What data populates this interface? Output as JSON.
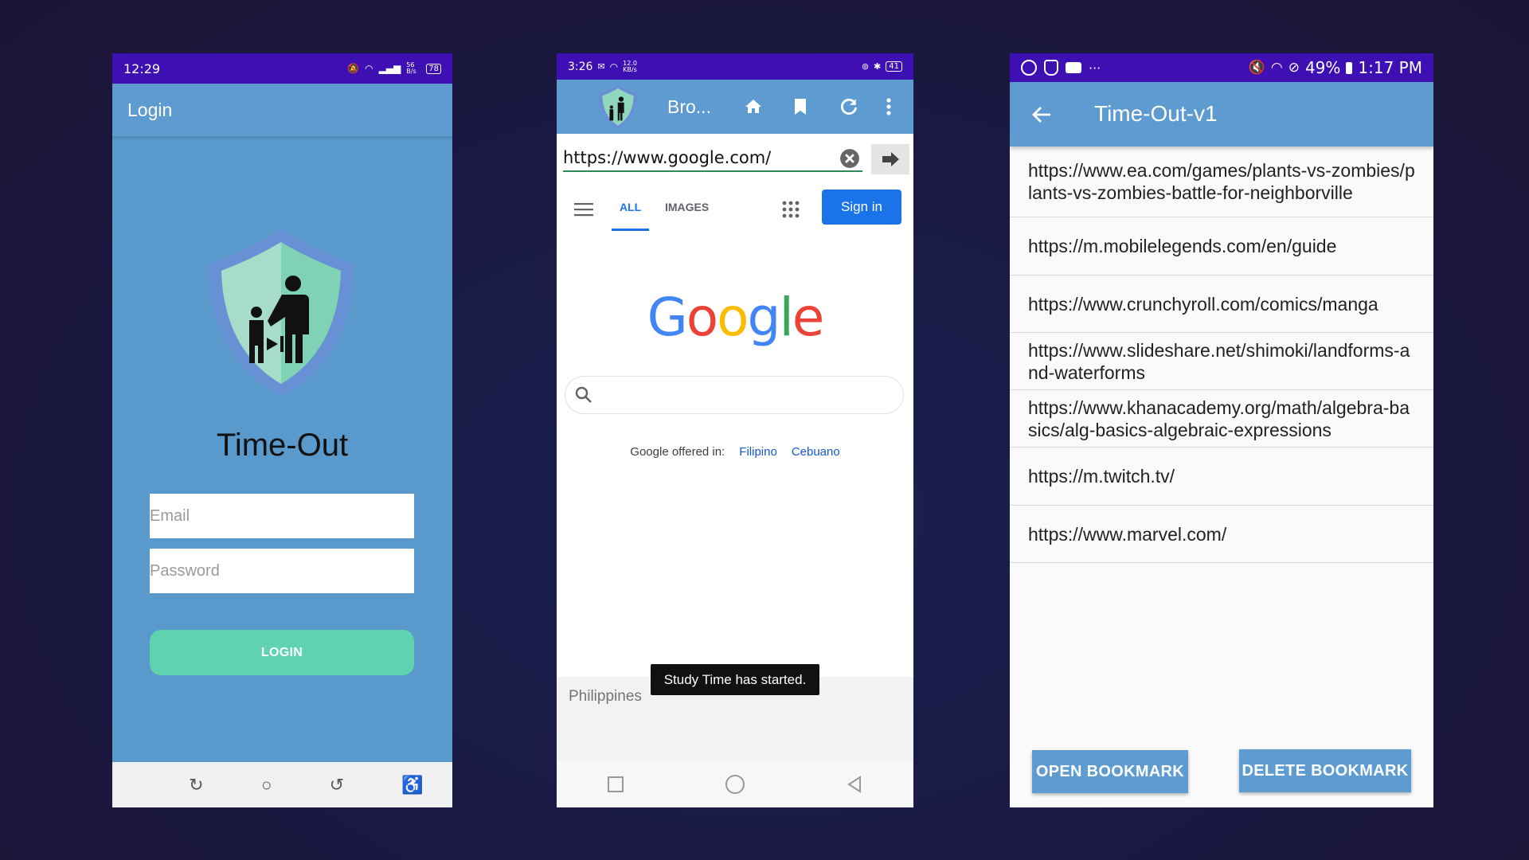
{
  "login_screen": {
    "status_time": "12:29",
    "status_net": "56 B/s",
    "status_battery": "78",
    "appbar_title": "Login",
    "app_name": "Time-Out",
    "email_placeholder": "Email",
    "password_placeholder": "Password",
    "login_label": "LOGIN"
  },
  "browser_screen": {
    "status_time": "3:26",
    "status_net": "12.0 KB/s",
    "status_battery": "41",
    "title": "Bro...",
    "url_value": "https://www.google.com/",
    "tabs": [
      "ALL",
      "IMAGES"
    ],
    "signin_label": "Sign in",
    "logo_letters": [
      "G",
      "o",
      "o",
      "g",
      "l",
      "e"
    ],
    "offered_label": "Google offered in:",
    "languages": [
      "Filipino",
      "Cebuano"
    ],
    "footer_country": "Philippines",
    "toast": "Study Time has started."
  },
  "bookmarks_screen": {
    "status_battery": "49%",
    "status_time": "1:17 PM",
    "title": "Time-Out-v1",
    "bookmarks": [
      "https://www.ea.com/games/plants-vs-zombies/plants-vs-zombies-battle-for-neighborville",
      "https://m.mobilelegends.com/en/guide",
      "https://www.crunchyroll.com/comics/manga",
      "https://www.slideshare.net/shimoki/landforms-and-waterforms",
      "https://www.khanacademy.org/math/algebra-basics/alg-basics-algebraic-expressions",
      "https://m.twitch.tv/",
      "https://www.marvel.com/"
    ],
    "open_label": "OPEN BOOKMARK",
    "delete_label": "DELETE BOOKMARK"
  },
  "colors": {
    "status_bar": "#3e10b4",
    "app_blue": "#5e9bd0",
    "login_button": "#5fd3b0",
    "google_blue": "#4285F4",
    "google_red": "#EA4335",
    "google_yellow": "#FBBC05",
    "google_green": "#34A853"
  }
}
